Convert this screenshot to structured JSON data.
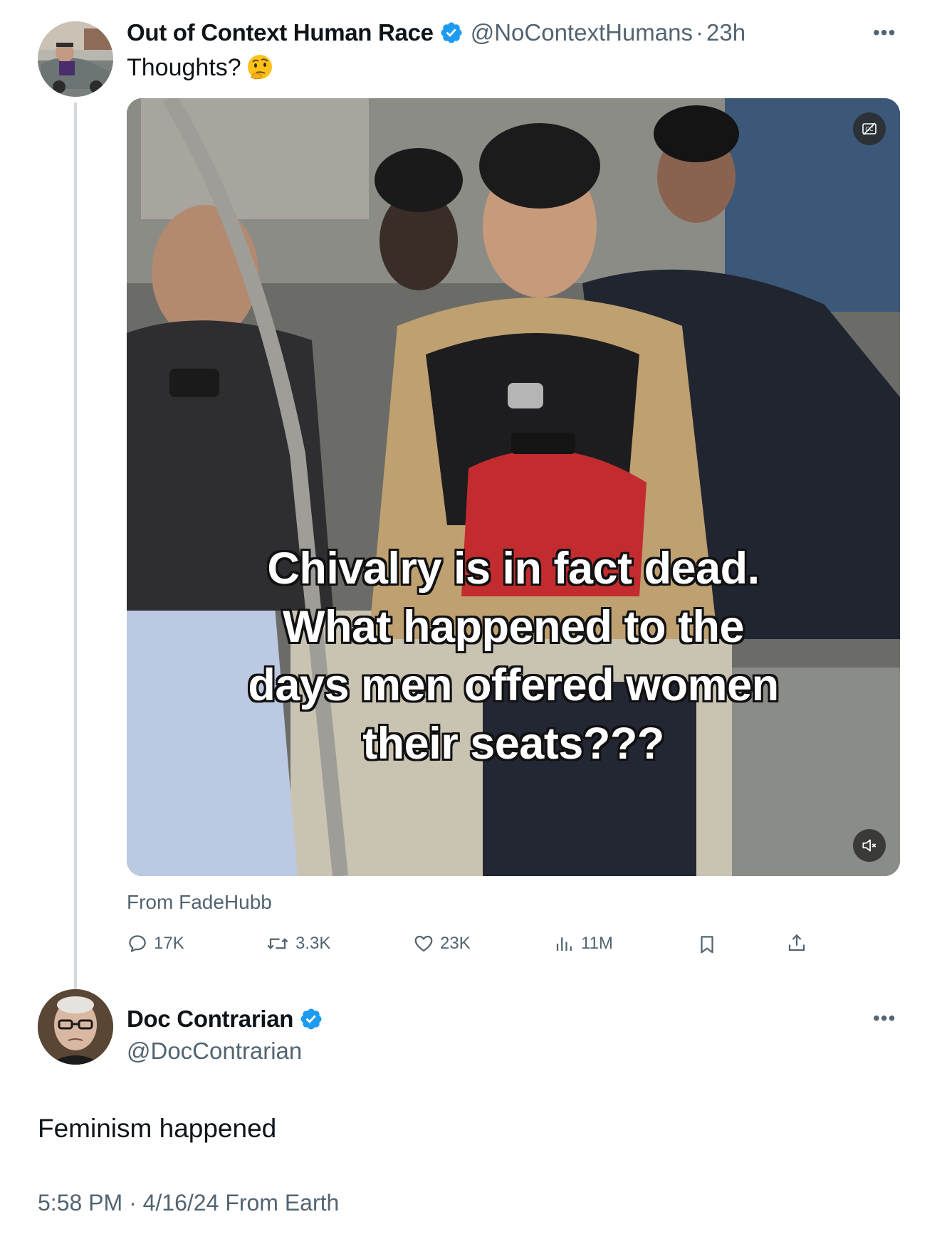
{
  "original_tweet": {
    "display_name": "Out of Context Human Race",
    "handle": "@NoContextHumans",
    "separator": "·",
    "time": "23h",
    "more_label": "•••",
    "text": "Thoughts?",
    "emoji": "thinking-face-icon",
    "media": {
      "caption_lines": [
        "Chivalry is in fact dead.",
        "What happened to the",
        "days men offered women",
        "their seats???"
      ],
      "captions_button": "captions-icon",
      "mute_button": "muted-speaker-icon"
    },
    "source": "From FadeHubb",
    "stats": {
      "replies": "17K",
      "reposts": "3.3K",
      "likes": "23K",
      "views": "11M"
    }
  },
  "reply_tweet": {
    "display_name": "Doc Contrarian",
    "handle": "@DocContrarian",
    "more_label": "•••",
    "text": "Feminism happened",
    "timestamp": "5:58 PM · 4/16/24 From Earth"
  },
  "colors": {
    "verified_blue": "#1d9bf0",
    "secondary_text": "#536471",
    "thread_line": "#cfd9de"
  }
}
